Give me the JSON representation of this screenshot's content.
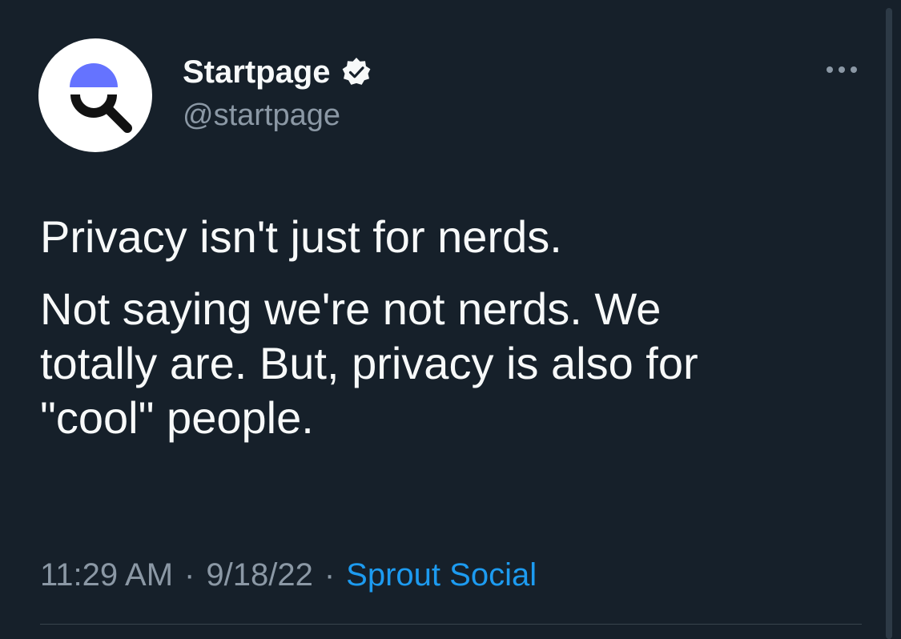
{
  "author": {
    "display_name": "Startpage",
    "handle": "@startpage",
    "verified": true,
    "avatar_icon": "startpage-magnifier-logo-icon"
  },
  "tweet": {
    "paragraphs": [
      "Privacy isn't just for nerds.",
      "Not saying we're not nerds. We\ntotally are. But, privacy is also for\n\"cool\" people."
    ]
  },
  "meta": {
    "time": "11:29 AM",
    "separator": "·",
    "date": "9/18/22",
    "source": "Sprout Social"
  },
  "icons": {
    "verified": "verified-badge-icon",
    "more": "more-options-icon"
  },
  "colors": {
    "background": "#16202a",
    "text_primary": "#f7f9f9",
    "text_secondary": "#8b98a5",
    "link": "#1d9bf0",
    "brand_accent": "#6573ff"
  }
}
